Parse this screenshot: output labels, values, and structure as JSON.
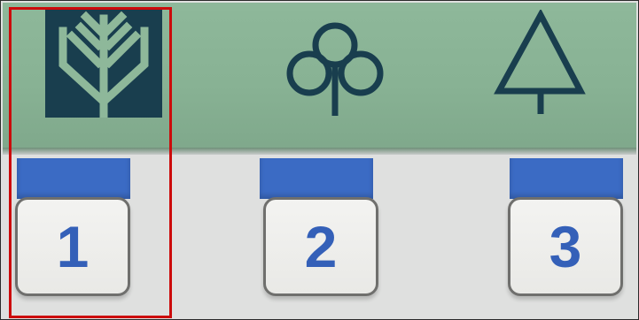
{
  "display": {
    "icons": [
      {
        "name": "deciduous-tree-frond-icon",
        "selected": true
      },
      {
        "name": "clover-tree-icon",
        "selected": false
      },
      {
        "name": "conifer-tree-icon",
        "selected": false
      }
    ],
    "lcd_color": "#88b294",
    "icon_color": "#193e4e"
  },
  "buttons": [
    {
      "label": "1"
    },
    {
      "label": "2"
    },
    {
      "label": "3"
    }
  ],
  "colors": {
    "tab_blue": "#3b6bc4",
    "digit_blue": "#3460b8",
    "selection_red": "#cc0b0b"
  }
}
